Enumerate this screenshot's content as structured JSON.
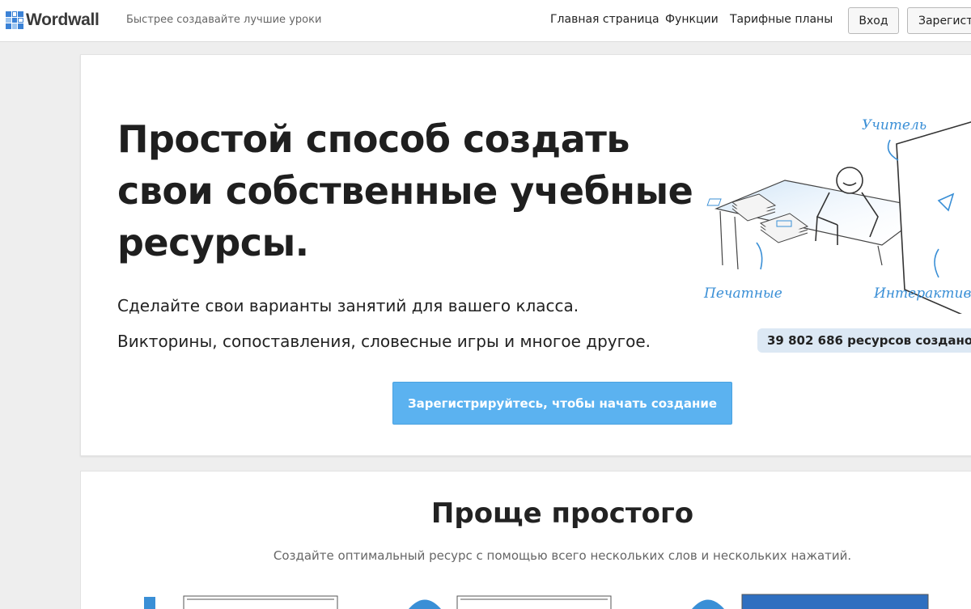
{
  "header": {
    "logo_text": "Wordwall",
    "tagline": "Быстрее создавайте лучшие уроки",
    "nav": {
      "home": "Главная страница",
      "features": "Функции",
      "pricing": "Тарифные планы"
    },
    "login_label": "Вход",
    "signup_label": "Зарегистрироваться"
  },
  "hero": {
    "title": "Простой способ создать свои собственные учебные ресурсы.",
    "subtitle_1": "Сделайте свои варианты занятий для вашего класса.",
    "subtitle_2": "Викторины, сопоставления, словесные игры и многое другое.",
    "illustration_labels": {
      "teacher": "Учитель",
      "printable": "Печатные",
      "interactive": "Интерактив"
    },
    "counter": "39 802 686 ресурсов создано",
    "cta_label": "Зарегистрируйтесь, чтобы начать создание"
  },
  "section2": {
    "title": "Проще простого",
    "subtitle": "Создайте оптимальный ресурс с помощью всего нескольких слов и нескольких нажатий."
  },
  "colors": {
    "accent": "#5bb2f0",
    "badge_bg": "#dce8f4",
    "illustration_blue": "#3a8fd6"
  }
}
